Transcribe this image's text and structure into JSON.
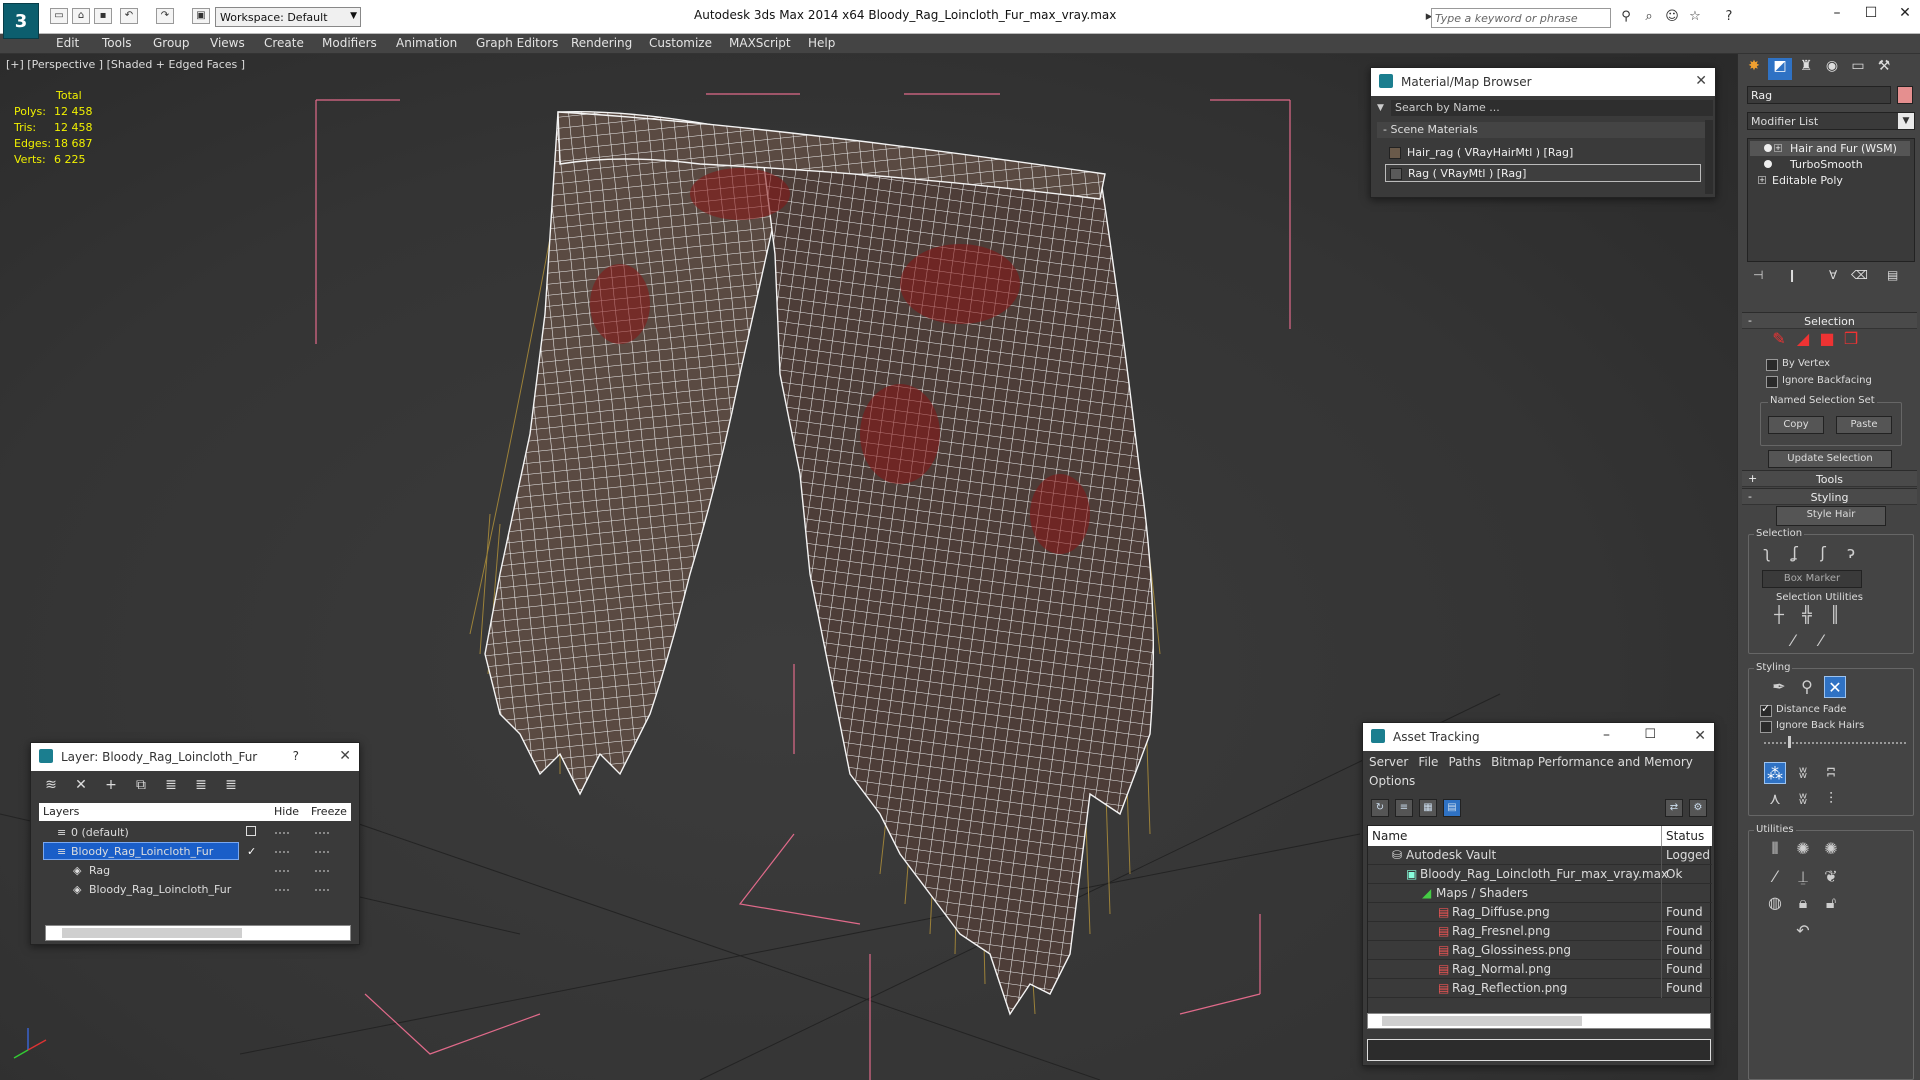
{
  "app": {
    "title": "Autodesk 3ds Max  2014 x64      Bloody_Rag_Loincloth_Fur_max_vray.max",
    "workspace": "Workspace: Default",
    "search_placeholder": "Type a keyword or phrase"
  },
  "menu": [
    "Edit",
    "Tools",
    "Group",
    "Views",
    "Create",
    "Modifiers",
    "Animation",
    "Graph Editors",
    "Rendering",
    "Customize",
    "MAXScript",
    "Help"
  ],
  "viewport": {
    "label": "[+] [Perspective ] [Shaded + Edged Faces ]",
    "stats": {
      "header": "Total",
      "rows": [
        {
          "label": "Polys:",
          "value": "12 458"
        },
        {
          "label": "Tris:",
          "value": "12 458"
        },
        {
          "label": "Edges:",
          "value": "18 687"
        },
        {
          "label": "Verts:",
          "value": "6 225"
        }
      ]
    }
  },
  "material_browser": {
    "title": "Material/Map Browser",
    "search": "Search by Name ...",
    "section": "- Scene Materials",
    "items": [
      "Hair_rag  ( VRayHairMtl )  [Rag]",
      "Rag  ( VRayMtl )  [Rag]"
    ]
  },
  "layer_panel": {
    "title": "Layer: Bloody_Rag_Loincloth_Fur",
    "help": "?",
    "columns": {
      "layers": "Layers",
      "hide": "Hide",
      "freeze": "Freeze"
    },
    "rows": [
      "0 (default)",
      "Bloody_Rag_Loincloth_Fur",
      "Rag",
      "Bloody_Rag_Loincloth_Fur"
    ]
  },
  "asset_tracking": {
    "title": "Asset Tracking",
    "menu": [
      "Server",
      "File",
      "Paths",
      "Bitmap Performance and Memory",
      "Options"
    ],
    "columns": {
      "name": "Name",
      "status": "Status"
    },
    "rows": [
      {
        "name": "Autodesk Vault",
        "status": "Logged O"
      },
      {
        "name": "Bloody_Rag_Loincloth_Fur_max_vray.max",
        "status": "Ok"
      },
      {
        "name": "Maps / Shaders",
        "status": ""
      },
      {
        "name": "Rag_Diffuse.png",
        "status": "Found"
      },
      {
        "name": "Rag_Fresnel.png",
        "status": "Found"
      },
      {
        "name": "Rag_Glossiness.png",
        "status": "Found"
      },
      {
        "name": "Rag_Normal.png",
        "status": "Found"
      },
      {
        "name": "Rag_Reflection.png",
        "status": "Found"
      }
    ]
  },
  "command_panel": {
    "object_name": "Rag",
    "object_color": "#e58f8f",
    "modifier_list": "Modifier List",
    "stack": [
      "Hair and Fur (WSM)",
      "TurboSmooth",
      "Editable Poly"
    ],
    "rollouts": {
      "selection": "Selection",
      "tools": "Tools",
      "styling": "Styling"
    },
    "selection": {
      "by_vertex": "By Vertex",
      "ignore_backfacing": "Ignore Backfacing",
      "named_sets": "Named Selection Set",
      "copy": "Copy",
      "paste": "Paste",
      "update": "Update Selection"
    },
    "styling": {
      "style_hair": "Style Hair",
      "selection_group": "Selection",
      "box_marker": "Box Marker",
      "selection_utilities": "Selection Utilities",
      "styling_group": "Styling",
      "distance_fade": "Distance Fade",
      "ignore_back_hairs": "Ignore Back Hairs",
      "utilities_group": "Utilities"
    }
  }
}
